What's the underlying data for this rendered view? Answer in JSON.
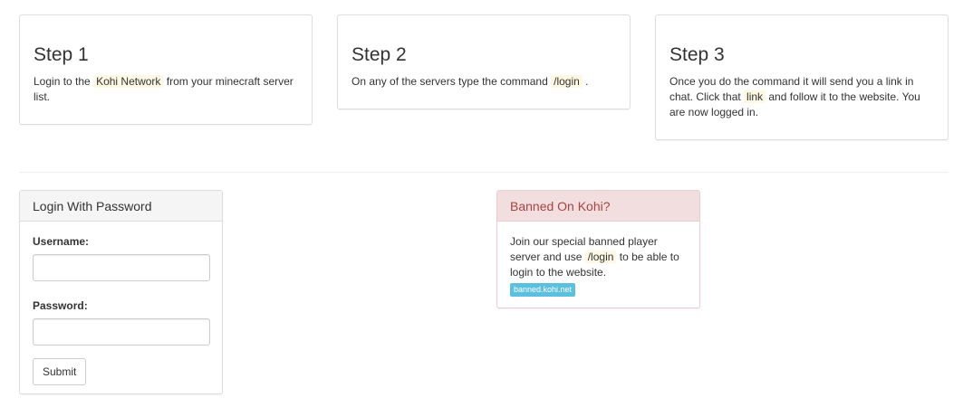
{
  "steps": [
    {
      "title": "Step 1",
      "text_before": "Login to the ",
      "highlight": "Kohi Network",
      "text_after": " from your minecraft server list."
    },
    {
      "title": "Step 2",
      "text_before": "On any of the servers type the command ",
      "highlight": "/login",
      "text_after": " ."
    },
    {
      "title": "Step 3",
      "text_before": "Once you do the command it will send you a link in chat. Click that ",
      "highlight": "link",
      "text_after": " and follow it to the website. You are now logged in."
    }
  ],
  "login_panel": {
    "heading": "Login With Password",
    "username_label": "Username:",
    "username_value": "",
    "password_label": "Password:",
    "password_value": "",
    "submit_label": "Submit"
  },
  "banned_panel": {
    "heading": "Banned On Kohi?",
    "text_before": "Join our special banned player server and use ",
    "highlight": "/login",
    "text_after": " to be able to login to the website.",
    "server_link": "banned.kohi.net"
  },
  "colors": {
    "highlight_bg": "#fcf8e3",
    "danger_heading_bg": "#f2dede",
    "danger_heading_text": "#a94442",
    "info_badge": "#5bc0de"
  }
}
